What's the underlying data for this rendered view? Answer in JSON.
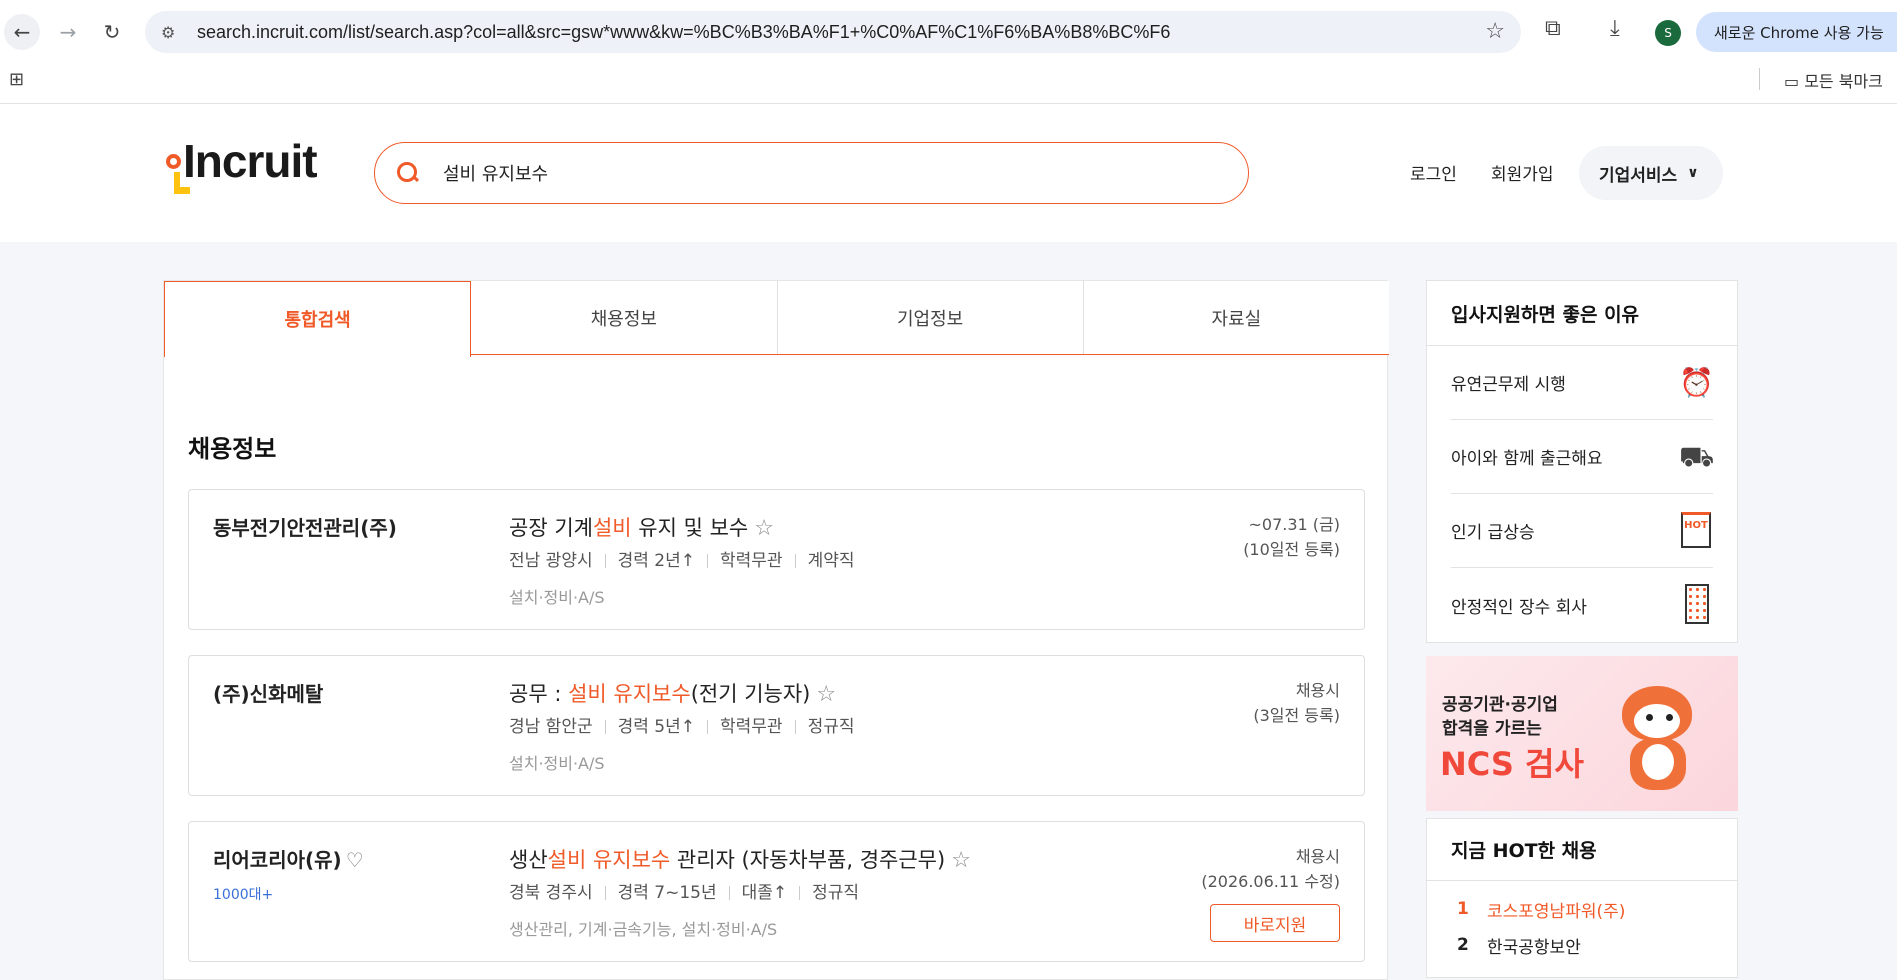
{
  "browser": {
    "url": "search.incruit.com/list/search.asp?col=all&src=gsw*www&kw=%BC%B3%BA%F1+%C0%AF%C1%F6%BA%B8%BC%F6",
    "profile_initial": "S",
    "update_label": "새로운 Chrome 사용 가능",
    "all_bookmarks": "모든 북마크"
  },
  "header": {
    "logo": "Incruit",
    "search_value": "설비 유지보수",
    "login": "로그인",
    "signup": "회원가입",
    "biz_service": "기업서비스"
  },
  "tabs": [
    {
      "label": "통합검색",
      "active": true
    },
    {
      "label": "채용정보",
      "active": false
    },
    {
      "label": "기업정보",
      "active": false
    },
    {
      "label": "자료실",
      "active": false
    }
  ],
  "section_title": "채용정보",
  "jobs": [
    {
      "company": "동부전기안전관리(주)",
      "title_pre": "공장 기계",
      "title_hl": "설비",
      "title_post": " 유지 및 보수",
      "meta": [
        "전남 광양시",
        "경력 2년↑",
        "학력무관",
        "계약직"
      ],
      "category": "설치·정비·A/S",
      "deadline": "~07.31 (금)",
      "posted": "(10일전 등록)"
    },
    {
      "company": "(주)신화메탈",
      "title_pre": "공무 : ",
      "title_hl": "설비 유지보수",
      "title_post": "(전기 기능자)",
      "meta": [
        "경남 함안군",
        "경력 5년↑",
        "학력무관",
        "정규직"
      ],
      "category": "설치·정비·A/S",
      "deadline": "채용시",
      "posted": "(3일전 등록)"
    },
    {
      "company": "리어코리아(유)",
      "badge": "1000대+",
      "title_pre": "생산",
      "title_hl": "설비 유지보수",
      "title_post": " 관리자 (자동차부품, 경주근무)",
      "meta": [
        "경북 경주시",
        "경력 7~15년",
        "대졸↑",
        "정규직"
      ],
      "category": "생산관리,  기계·금속기능,  설치·정비·A/S",
      "deadline": "채용시",
      "posted": "(2026.06.11 수정)",
      "apply_label": "바로지원"
    }
  ],
  "sidebar": {
    "reasons_title": "입사지원하면 좋은 이유",
    "reasons": [
      "유연근무제 시행",
      "아이와 함께 출근해요",
      "인기 급상승",
      "안정적인 장수 회사"
    ],
    "banner_line1": "공공기관·공기업",
    "banner_line2": "합격을 가르는",
    "banner_big": "NCS 검사",
    "hot_title": "지금 HOT한 채용",
    "hot_list": [
      {
        "rank": "1",
        "name": "코스포영남파워(주)"
      },
      {
        "rank": "2",
        "name": "한국공항보안"
      }
    ],
    "hot_icon_text": "HOT"
  }
}
